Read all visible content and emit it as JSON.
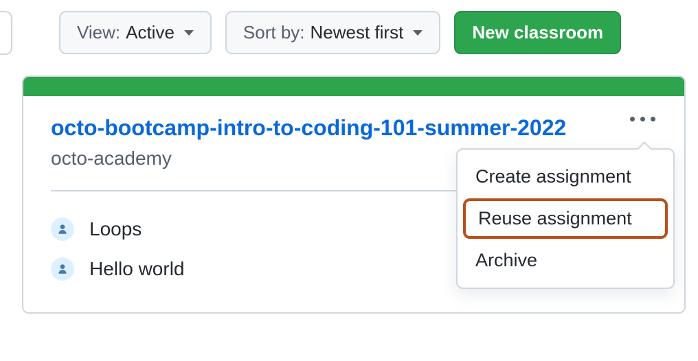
{
  "toolbar": {
    "view": {
      "prefix": "View: ",
      "value": "Active"
    },
    "sort": {
      "prefix": "Sort by: ",
      "value": "Newest first"
    },
    "new_classroom": "New classroom"
  },
  "classroom": {
    "title": "octo-bootcamp-intro-to-coding-101-summer-2022",
    "org": "octo-academy",
    "assignments": [
      {
        "name": "Loops"
      },
      {
        "name": "Hello world"
      }
    ]
  },
  "menu": {
    "create": "Create assignment",
    "reuse": "Reuse assignment",
    "archive": "Archive"
  }
}
